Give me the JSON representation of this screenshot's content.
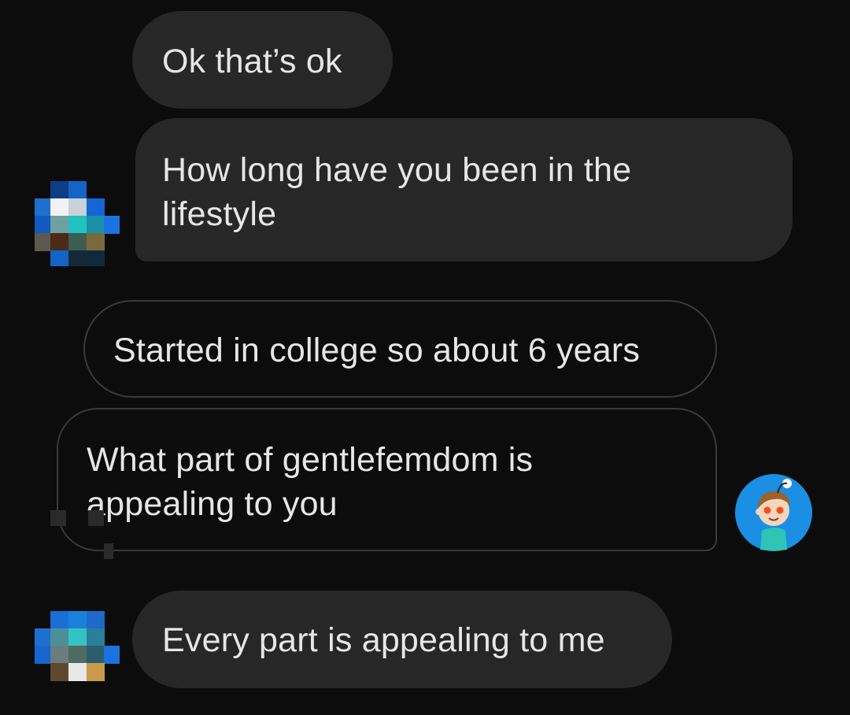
{
  "conversation": {
    "messages": [
      {
        "sender": "other",
        "text": "Ok  that’s ok"
      },
      {
        "sender": "other",
        "lines": [
          "How long have you been in the",
          "lifestyle"
        ]
      },
      {
        "sender": "self",
        "text": "Started in college so about 6 years"
      },
      {
        "sender": "self",
        "lines": [
          "What part of gentlefemdom is",
          "appealing to you"
        ]
      },
      {
        "sender": "other",
        "text": "Every part is appealing to me"
      }
    ]
  },
  "avatars": {
    "other_icon": "pixelated-avatar-icon",
    "self_icon": "reddit-snoo-avatar-icon"
  },
  "colors": {
    "background": "#0c0c0c",
    "incoming_bubble": "#272727",
    "outgoing_border": "#3a3a3a",
    "text": "#e6e6e6",
    "snoo_blue": "#1a8fe3"
  }
}
